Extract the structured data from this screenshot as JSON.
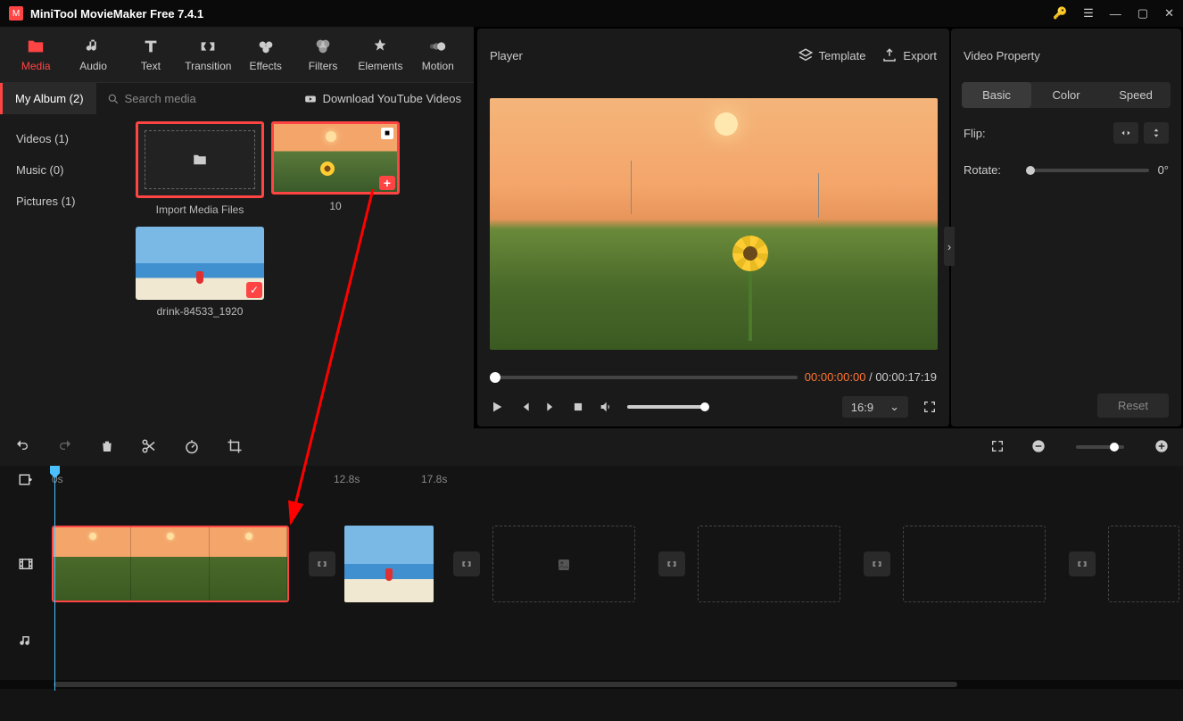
{
  "app": {
    "title": "MiniTool MovieMaker Free 7.4.1"
  },
  "top_tabs": [
    {
      "label": "Media",
      "active": true
    },
    {
      "label": "Audio"
    },
    {
      "label": "Text"
    },
    {
      "label": "Transition"
    },
    {
      "label": "Effects"
    },
    {
      "label": "Filters"
    },
    {
      "label": "Elements"
    },
    {
      "label": "Motion"
    }
  ],
  "album": {
    "tab": "My Album (2)",
    "search_placeholder": "Search media",
    "download": "Download YouTube Videos"
  },
  "sidebar": {
    "items": [
      {
        "label": "Videos (1)"
      },
      {
        "label": "Music (0)"
      },
      {
        "label": "Pictures (1)"
      }
    ]
  },
  "media": {
    "import_label": "Import Media Files",
    "clip1_label": "10",
    "clip2_label": "drink-84533_1920"
  },
  "player": {
    "title": "Player",
    "template": "Template",
    "export": "Export",
    "current": "00:00:00:00",
    "duration": "00:00:17:19",
    "aspect": "16:9"
  },
  "props": {
    "title": "Video Property",
    "tabs": [
      {
        "label": "Basic",
        "active": true
      },
      {
        "label": "Color"
      },
      {
        "label": "Speed"
      }
    ],
    "flip_label": "Flip:",
    "rotate_label": "Rotate:",
    "rotate_value": "0°",
    "reset": "Reset"
  },
  "ruler": {
    "ticks": [
      {
        "label": "0s",
        "pos": 0
      },
      {
        "label": "12.8s",
        "pos": 316
      },
      {
        "label": "17.8s",
        "pos": 414
      }
    ]
  }
}
